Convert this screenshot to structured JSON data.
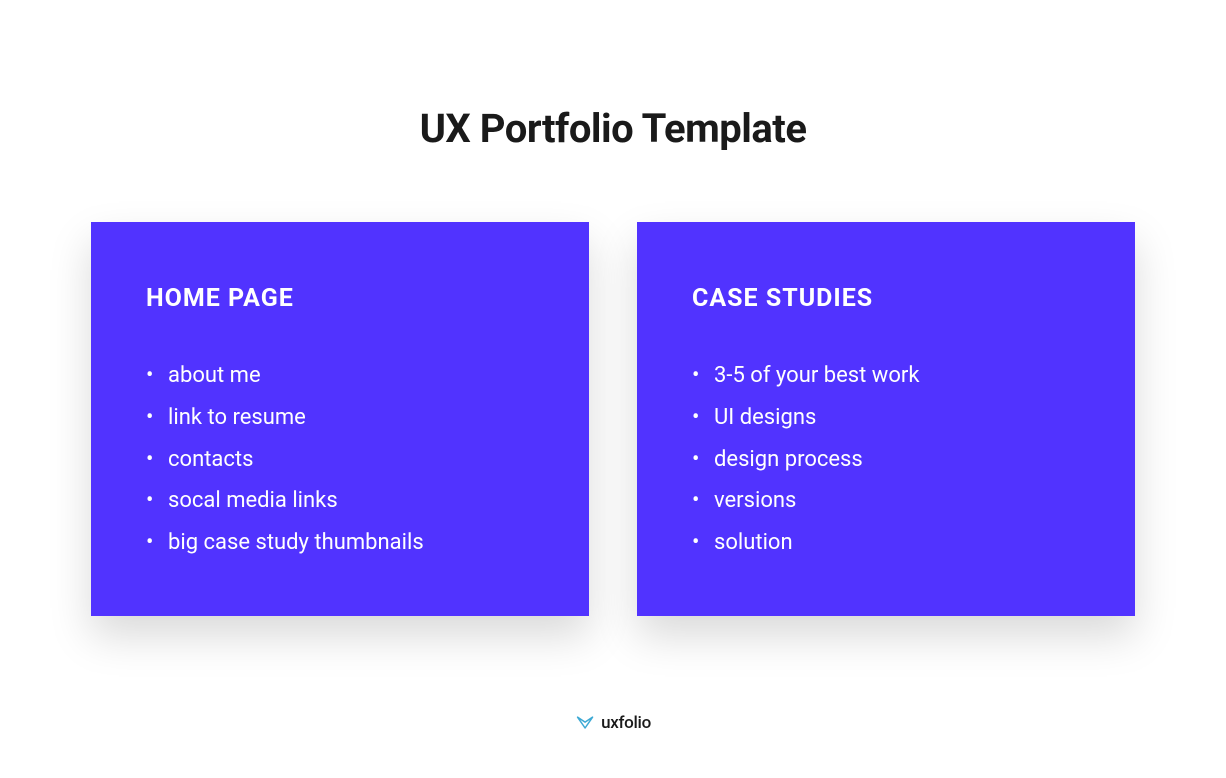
{
  "title": "UX Portfolio Template",
  "cards": [
    {
      "header": "HOME PAGE",
      "items": [
        "about me",
        "link to resume",
        "contacts",
        "socal media links",
        "big case study thumbnails"
      ]
    },
    {
      "header": "CASE STUDIES",
      "items": [
        "3-5 of your best work",
        "UI designs",
        "design process",
        "versions",
        "solution"
      ]
    }
  ],
  "footer": {
    "brand": "uxfolio"
  },
  "colors": {
    "card_bg": "#5133ff",
    "text_dark": "#1a1a1a",
    "text_light": "#ffffff"
  }
}
